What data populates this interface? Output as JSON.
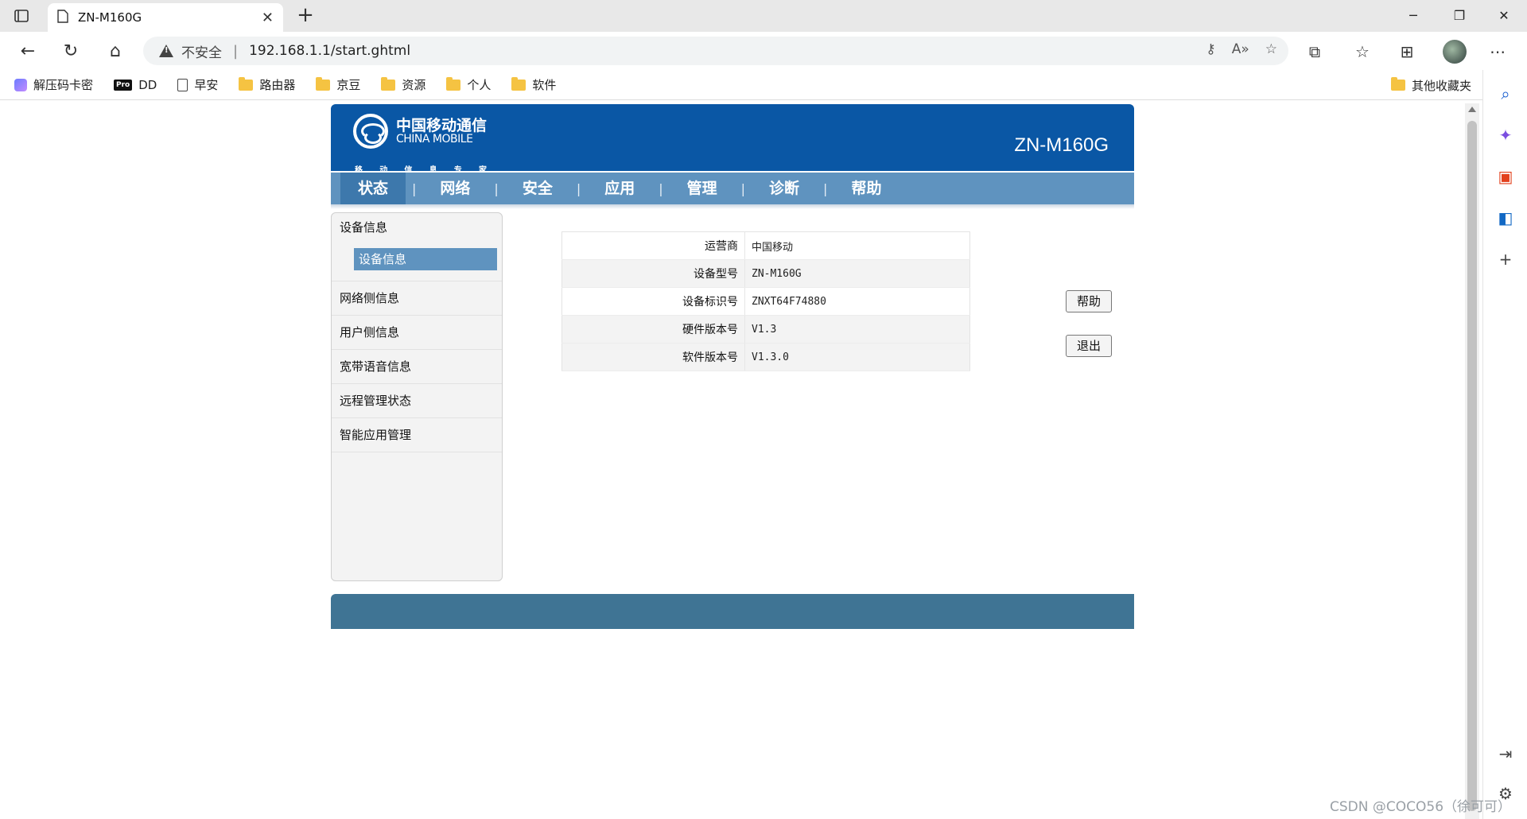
{
  "browser": {
    "tab_title": "ZN-M160G",
    "security_text": "不安全",
    "url": "192.168.1.1/start.ghtml",
    "bookmarks": [
      "解压码卡密",
      "DD",
      "早安",
      "路由器",
      "京豆",
      "资源",
      "个人",
      "软件"
    ],
    "pro_badge": "Pro",
    "other_bookmarks": "其他收藏夹"
  },
  "router": {
    "logo_cn": "中国移动通信",
    "logo_en": "CHINA MOBILE",
    "logo_sub": [
      "移",
      "动",
      "信",
      "息",
      "专",
      "家"
    ],
    "model": "ZN-M160G",
    "menu": [
      "状态",
      "网络",
      "安全",
      "应用",
      "管理",
      "诊断",
      "帮助"
    ],
    "menu_active": "状态",
    "left_nav": {
      "groups": [
        "设备信息",
        "网络侧信息",
        "用户侧信息",
        "宽带语音信息",
        "远程管理状态",
        "智能应用管理"
      ],
      "selected_sub": "设备信息"
    },
    "device_info": [
      {
        "label": "运营商",
        "value": "中国移动"
      },
      {
        "label": "设备型号",
        "value": "ZN-M160G"
      },
      {
        "label": "设备标识号",
        "value": "ZNXT64F74880"
      },
      {
        "label": "硬件版本号",
        "value": "V1.3"
      },
      {
        "label": "软件版本号",
        "value": "V1.3.0"
      }
    ],
    "buttons": {
      "help": "帮助",
      "logout": "退出"
    }
  },
  "watermark": "CSDN @COCO56（徐可可）"
}
